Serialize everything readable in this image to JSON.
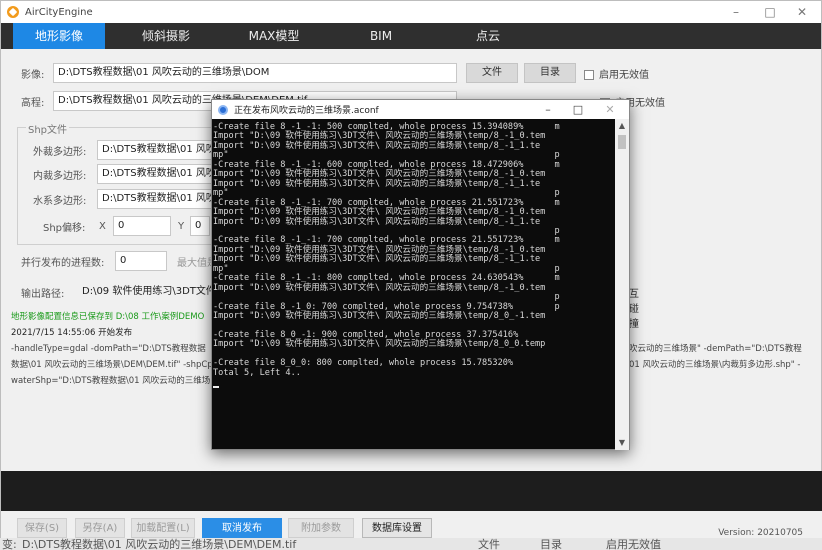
{
  "window": {
    "title": "AirCityEngine",
    "min": "–",
    "max": "□",
    "close": "✕"
  },
  "tabs": [
    {
      "label": "地形影像",
      "active": true
    },
    {
      "label": "倾斜摄影"
    },
    {
      "label": "MAX模型"
    },
    {
      "label": "BIM"
    },
    {
      "label": "点云"
    }
  ],
  "image_row": {
    "label": "影像:",
    "value": "D:\\DTS教程数据\\01 风吹云动的三维场景\\DOM",
    "file_btn": "文件",
    "dir_btn": "目录",
    "checkbox_label": "启用无效值"
  },
  "dem_row": {
    "label": "高程:",
    "value": "D:\\DTS教程数据\\01 风吹云动的三维场景\\DEM\\DEM.tif",
    "checkbox_label": "启用无效值"
  },
  "shp": {
    "legend": "Shp文件",
    "outer_label": "外裁多边形:",
    "outer_value": "D:\\DTS教程数据\\01 风吹",
    "inner_label": "内裁多边形:",
    "inner_value": "D:\\DTS教程数据\\01 风吹",
    "water_label": "水系多边形:",
    "water_value": "D:\\DTS教程数据\\01 风吹",
    "offset_label": "Shp偏移:",
    "x_label": "X",
    "x_value": "0",
    "y_label": "Y",
    "y_value": "0"
  },
  "parallel": {
    "label": "并行发布的进程数:",
    "value": "0",
    "max_label": "最大值是"
  },
  "output": {
    "label": "输出路径:",
    "value": "D:\\09 软件使用练习\\3DT文件",
    "right_label": "互碰撞"
  },
  "log": {
    "saved": "地形影像配置信息已保存到 D:\\08 工作\\案例DEMO",
    "start": "2021/7/15 14:55:06 开始发布",
    "line1_left": "-handleType=gdal -domPath=\"D:\\DTS教程数据",
    "line1_right": "吹云动的三维场景\" -demPath=\"D:\\DTS教程",
    "line2_left": "数据\\01 风吹云动的三维场景\\DEM\\DEM.tif\" -shpCp",
    "line2_right": "01 风吹云动的三维场景\\内裁剪多边形.shp\" -",
    "line3_left": "waterShp=\"D:\\DTS教程数据\\01 风吹云动的三维场"
  },
  "bottom": {
    "save": "保存(S)",
    "save_as": "另存(A)",
    "load": "加载配置(L)",
    "cancel": "取消发布",
    "extra": "附加参数",
    "db": "数据库设置",
    "version": "Version: 20210705"
  },
  "bg_strip_top": [
    "名",
    "方"
  ],
  "bg_strip_bottom": {
    "left": "变:",
    "path": "D:\\DTS教程数据\\01 风吹云动的三维场景\\DEM\\DEM.tif",
    "file": "文件",
    "dir": "目录",
    "cb": "启用无效值"
  },
  "console": {
    "title": "正在发布风吹云动的三维场景.aconf",
    "lines": [
      "-Create file 8_-1_-1: 500 complted, whole process 15.394089%      m",
      "Import \"D:\\09 软件使用练习\\3DT文件\\ 风吹云动的三维场景\\temp/8_-1_0.tem",
      "Import \"D:\\09 软件使用练习\\3DT文件\\ 风吹云动的三维场景\\temp/8_-1_1.te",
      "mp\"                                                               p",
      "-Create file 8_-1_-1: 600 complted, whole process 18.472906%      m",
      "Import \"D:\\09 软件使用练习\\3DT文件\\ 风吹云动的三维场景\\temp/8_-1_0.tem",
      "Import \"D:\\09 软件使用练习\\3DT文件\\ 风吹云动的三维场景\\temp/8_-1_1.te",
      "mp\"                                                               p",
      "-Create file 8_-1_-1: 700 complted, whole process 21.551723%      m",
      "Import \"D:\\09 软件使用练习\\3DT文件\\ 风吹云动的三维场景\\temp/8_-1_0.tem",
      "Import \"D:\\09 软件使用练习\\3DT文件\\ 风吹云动的三维场景\\temp/8_-1_1.te",
      "                                                                  p",
      "-Create file 8_-1_-1: 700 complted, whole process 21.551723%      m",
      "Import \"D:\\09 软件使用练习\\3DT文件\\ 风吹云动的三维场景\\temp/8_-1_0.tem",
      "Import \"D:\\09 软件使用练习\\3DT文件\\ 风吹云动的三维场景\\temp/8_-1_1.te",
      "mp\"                                                               p",
      "-Create file 8_-1_-1: 800 complted, whole process 24.630543%      m",
      "Import \"D:\\09 软件使用练习\\3DT文件\\ 风吹云动的三维场景\\temp/8_-1_0.tem",
      "                                                                  p",
      "-Create file 8_-1_0: 700 complted, whole process 9.754738%        p",
      "Import \"D:\\09 软件使用练习\\3DT文件\\ 风吹云动的三维场景\\temp/8_0_-1.tem",
      "",
      "-Create file 8_0_-1: 900 complted, whole process 37.375416%",
      "Import \"D:\\09 软件使用练习\\3DT文件\\ 风吹云动的三维场景\\temp/8_0_0.temp",
      "",
      "-Create file 8_0_0: 800 complted, whole process 15.785320%",
      "Total 5, Left 4.."
    ]
  }
}
